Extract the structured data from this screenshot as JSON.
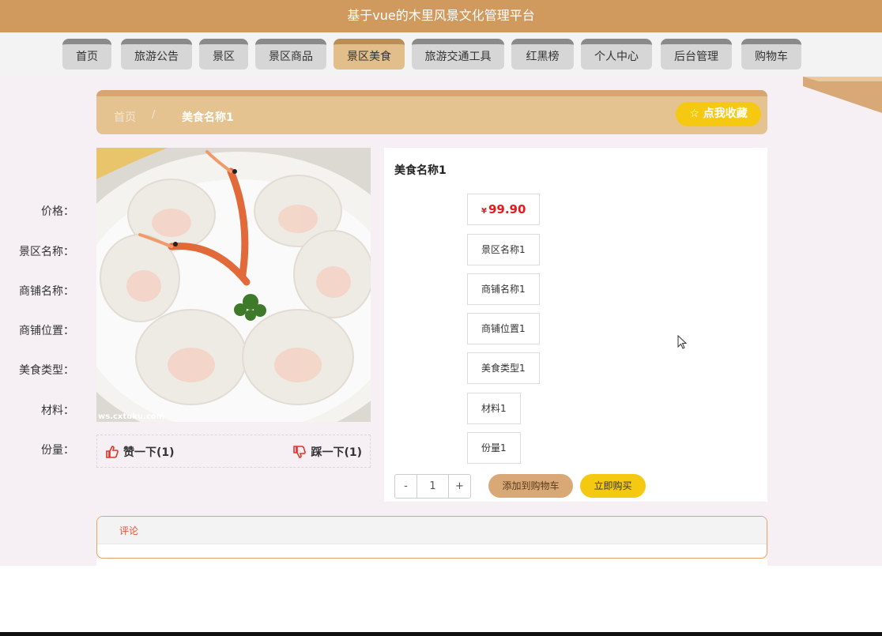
{
  "header": {
    "title": "基于vue的木里风景文化管理平台"
  },
  "nav": {
    "items": [
      {
        "label": "首页"
      },
      {
        "label": "旅游公告"
      },
      {
        "label": "景区"
      },
      {
        "label": "景区商品"
      },
      {
        "label": "景区美食"
      },
      {
        "label": "旅游交通工具"
      },
      {
        "label": "红黑榜"
      },
      {
        "label": "个人中心"
      },
      {
        "label": "后台管理"
      },
      {
        "label": "购物车"
      }
    ],
    "active_index": 4
  },
  "breadcrumb": {
    "home": "首页",
    "separator": "/",
    "current": "美食名称1"
  },
  "favorite": {
    "icon": "star-outline-icon",
    "label": "点我收藏"
  },
  "photo": {
    "watermark": "ws.cxtuku.com"
  },
  "reactions": {
    "like": {
      "icon": "thumbs-up-icon",
      "label": "赞一下(1)"
    },
    "dislike": {
      "icon": "thumbs-down-icon",
      "label": "踩一下(1)"
    }
  },
  "detail": {
    "title": "美食名称1",
    "fields": [
      {
        "label": "价格：",
        "currency": "¥",
        "value": "99.90"
      },
      {
        "label": "景区名称：",
        "value": "景区名称1"
      },
      {
        "label": "商铺名称：",
        "value": "商铺名称1"
      },
      {
        "label": "商铺位置：",
        "value": "商铺位置1"
      },
      {
        "label": "美食类型：",
        "value": "美食类型1"
      },
      {
        "label": "材料：",
        "value": "材料1"
      },
      {
        "label": "份量：",
        "value": "份量1"
      }
    ]
  },
  "purchase": {
    "minus": "-",
    "quantity": "1",
    "plus": "+",
    "add_to_cart": "添加到购物车",
    "buy_now": "立即购买"
  },
  "comments": {
    "tab_label": "评论"
  },
  "colors": {
    "header": "#d09a5e",
    "active_tab": "#e2bf8a",
    "breadcrumb_bg": "#e4c390",
    "favorite_btn": "#f5c912",
    "price": "#e21c1c",
    "cart_btn": "#d9a877",
    "comment_tab": "#e5533a"
  }
}
